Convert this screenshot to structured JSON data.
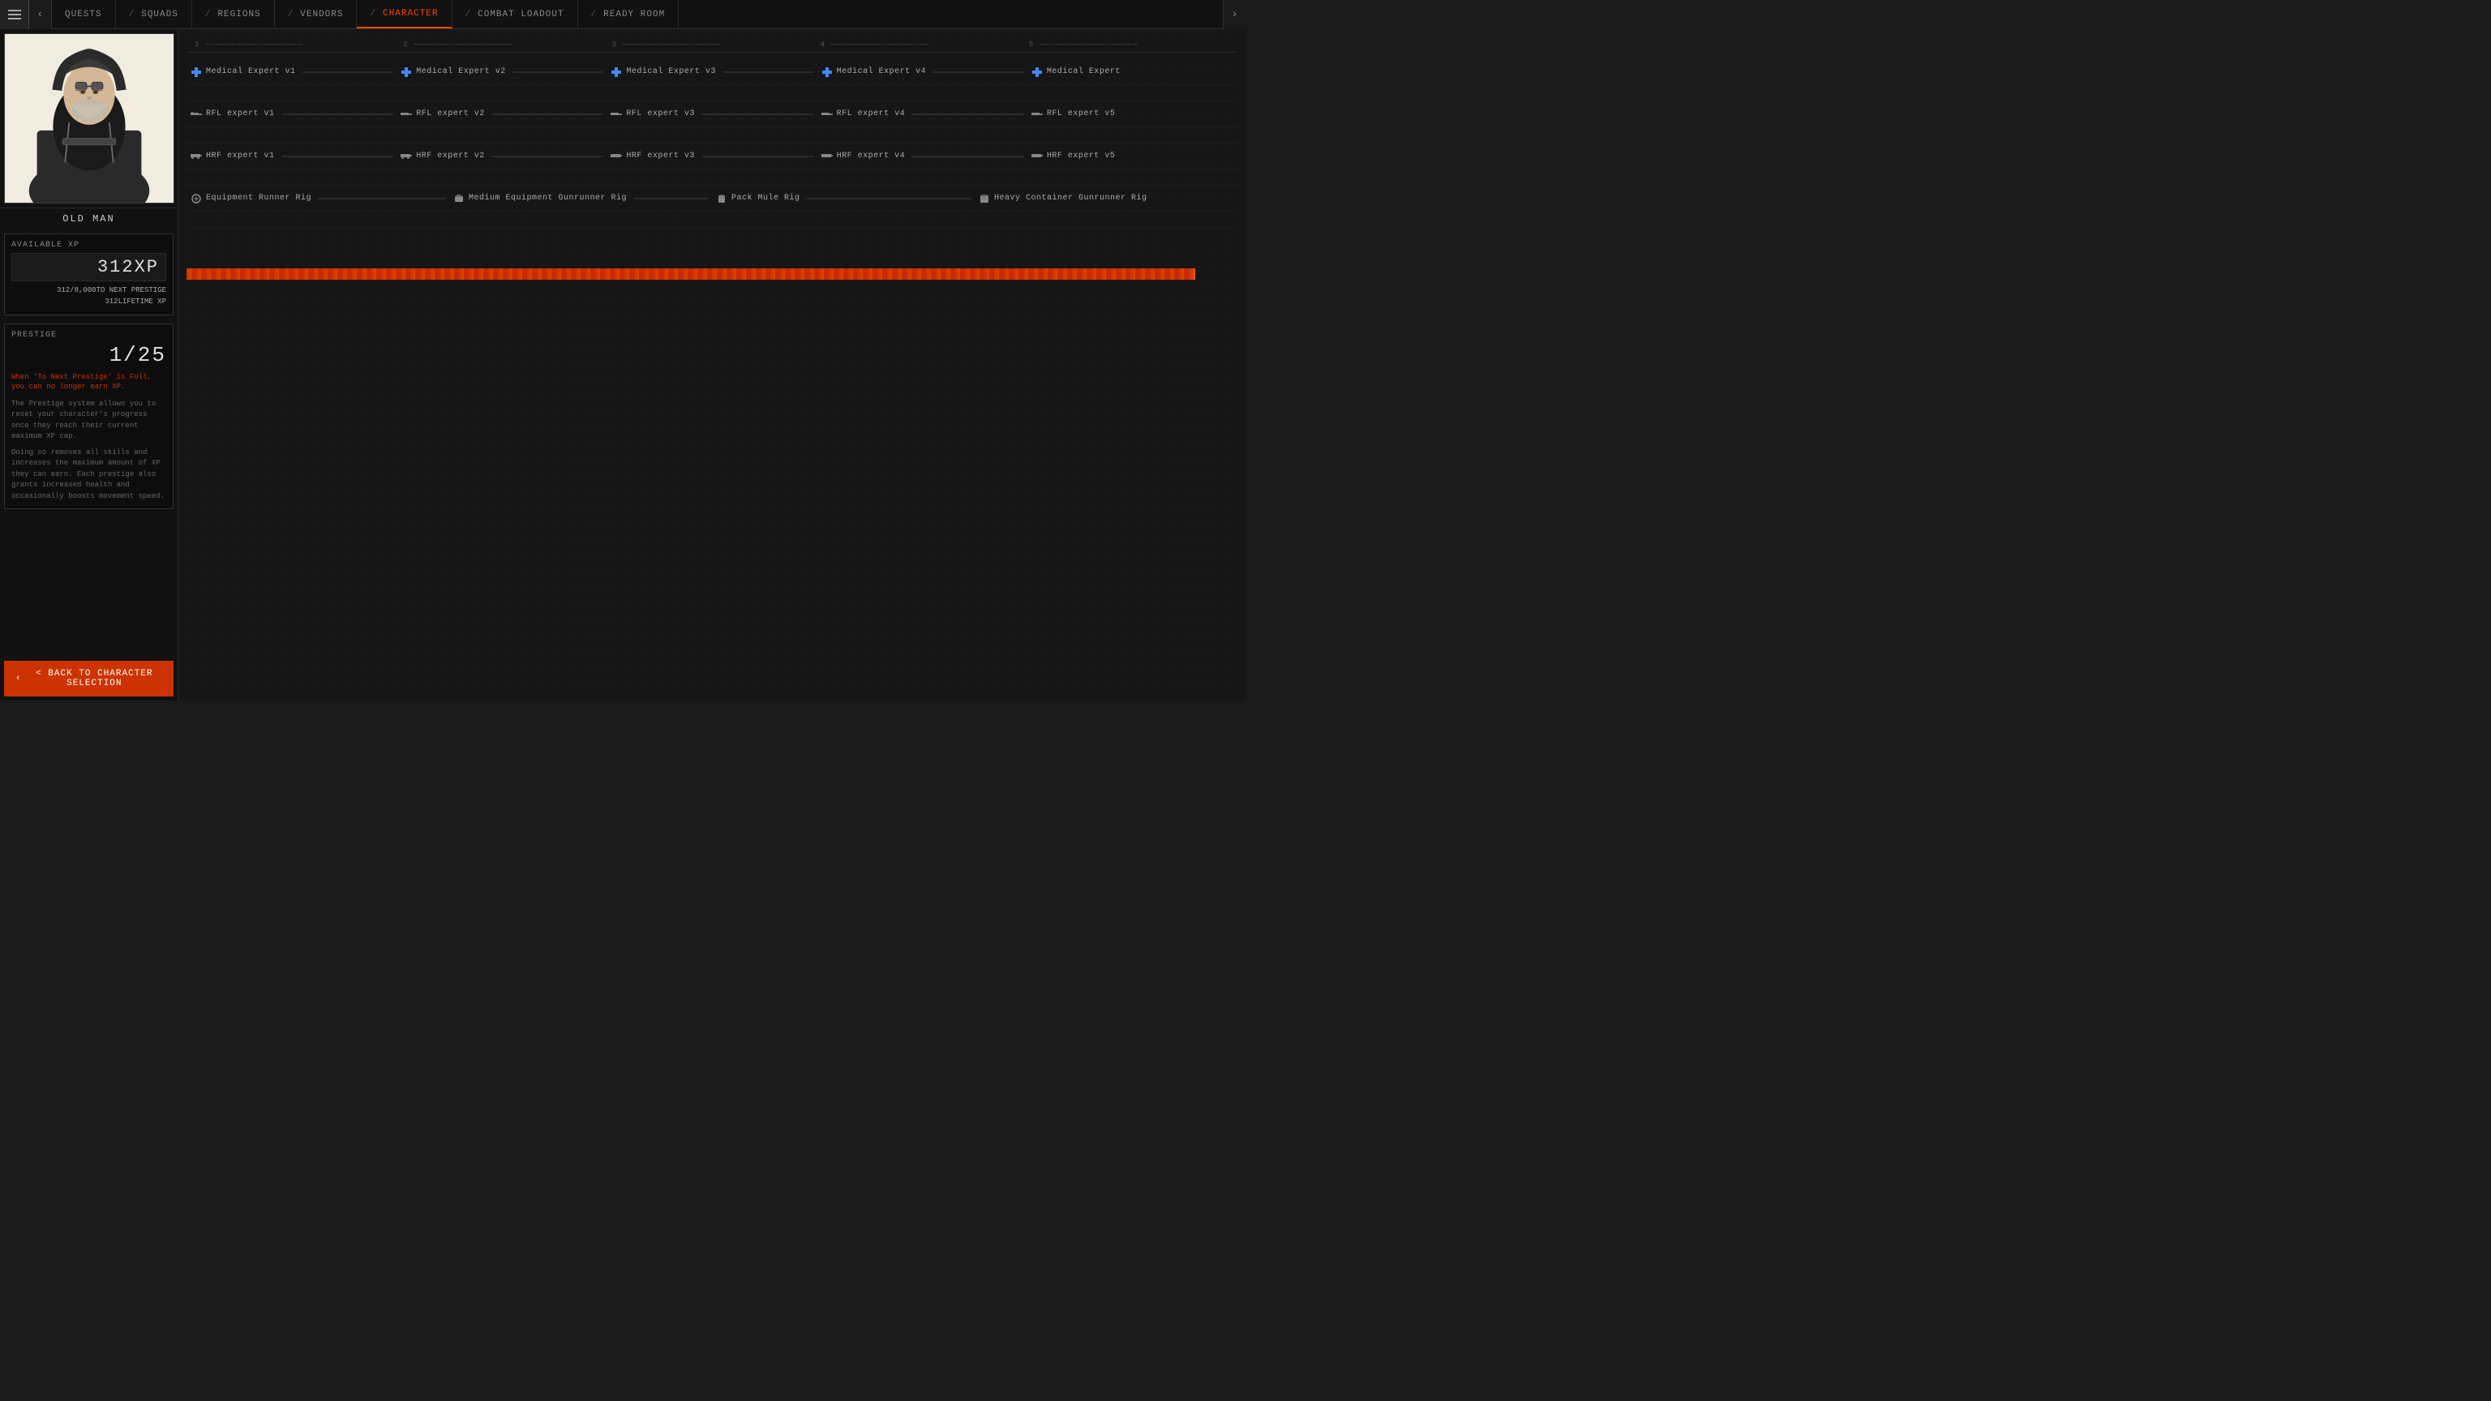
{
  "nav": {
    "items": [
      {
        "id": "quests",
        "label": "QUESTS",
        "active": false
      },
      {
        "id": "squads",
        "label": "SQUADS",
        "active": false
      },
      {
        "id": "regions",
        "label": "REGIONS",
        "active": false
      },
      {
        "id": "vendors",
        "label": "VENDORS",
        "active": false
      },
      {
        "id": "character",
        "label": "CHARACTER",
        "active": true
      },
      {
        "id": "combat-loadout",
        "label": "COMBAT LOADOUT",
        "active": false
      },
      {
        "id": "ready-room",
        "label": "READY ROOM",
        "active": false
      }
    ]
  },
  "character": {
    "name": "OLD MAN"
  },
  "xp": {
    "available_label": "AVAILABLE XP",
    "value": "312XP",
    "to_next_prestige_label": "TO NEXT PRESTIGE",
    "to_next_prestige_value": "312/8,000",
    "lifetime_label": "LIFETIME XP",
    "lifetime_value": "312",
    "prestige_label": "PRESTIGE",
    "prestige_value": "1/25",
    "warning": "When 'To Next Prestige' is Full, you can no longer earn XP.",
    "desc1": "The Prestige system allows you to reset your character's progress once they reach their current maximum XP cap.",
    "desc2": "Doing so removes all skills and increases the maximum amount of XP they can earn. Each prestige also grants increased health and occasionally boosts movement speed."
  },
  "back_button": "< BACK TO CHARACTER SELECTION",
  "tiers": {
    "labels": [
      "1",
      "2",
      "3",
      "4",
      "5"
    ]
  },
  "skills": {
    "rows": [
      {
        "type": "medical",
        "items": [
          {
            "name": "Medical Expert v1",
            "has_bar": true
          },
          {
            "name": "Medical Expert v2",
            "has_bar": true
          },
          {
            "name": "Medical Expert v3",
            "has_bar": true
          },
          {
            "name": "Medical Expert v4",
            "has_bar": true
          },
          {
            "name": "Medical Expert",
            "has_bar": false
          }
        ]
      },
      {
        "type": "spacer",
        "items": []
      },
      {
        "type": "rifle",
        "items": [
          {
            "name": "RFL expert v1",
            "has_bar": true
          },
          {
            "name": "RFL expert v2",
            "has_bar": true
          },
          {
            "name": "RFL expert v3",
            "has_bar": true
          },
          {
            "name": "RFL expert v4",
            "has_bar": true
          },
          {
            "name": "RFL expert v5",
            "has_bar": false
          }
        ]
      },
      {
        "type": "spacer",
        "items": []
      },
      {
        "type": "hrf",
        "items": [
          {
            "name": "HRF expert v1",
            "has_bar": true
          },
          {
            "name": "HRF expert v2",
            "has_bar": true
          },
          {
            "name": "HRF expert v3",
            "has_bar": true
          },
          {
            "name": "HRF expert v4",
            "has_bar": true
          },
          {
            "name": "HRF expert v5",
            "has_bar": false
          }
        ]
      },
      {
        "type": "spacer",
        "items": []
      },
      {
        "type": "rig",
        "items": [
          {
            "name": "Equipment Runner Rig",
            "has_bar": true
          },
          {
            "name": "Medium Equipment Gunrunner Rig",
            "has_bar": true
          },
          {
            "name": "Pack Mule Rig",
            "has_bar": true
          },
          {
            "name": "Heavy Container Gunrunner Rig",
            "has_bar": false
          }
        ]
      }
    ]
  },
  "progress_bar": {
    "percent": 96
  }
}
